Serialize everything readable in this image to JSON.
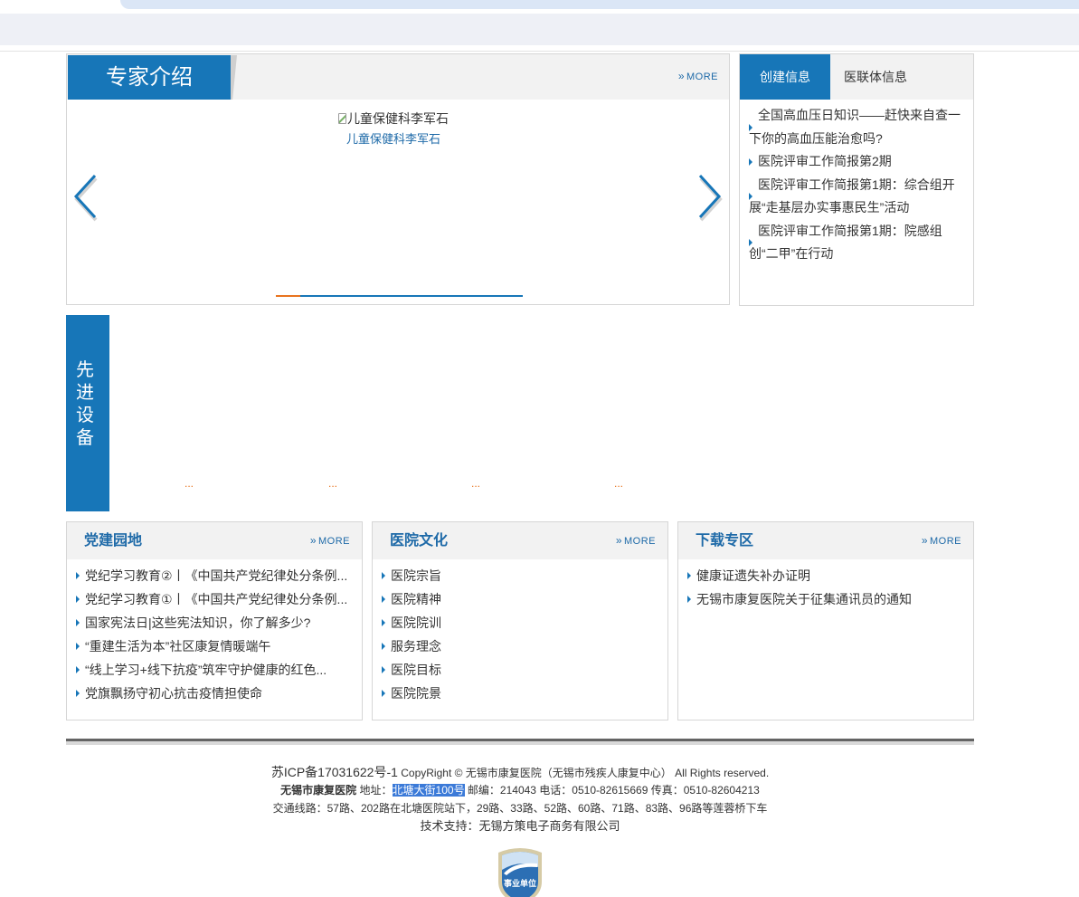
{
  "theme": {
    "primary": "#1776b8",
    "accent_orange": "#e8731e",
    "title_blue": "#1e6aa8",
    "selection": "#3b7ad8"
  },
  "expert": {
    "title": "专家介绍",
    "more_label": "MORE",
    "more_icon": "double-chevron-right-icon",
    "slide": {
      "image_icon": "broken-image-icon",
      "image_alt": "儿童保健科李军石",
      "caption": "儿童保健科李军石"
    },
    "carousel": {
      "prev_icon": "chevron-left-icon",
      "next_icon": "chevron-right-icon",
      "progress": 0.1
    }
  },
  "news": {
    "tabs": [
      {
        "label": "创建信息",
        "active": true
      },
      {
        "label": "医联体信息",
        "active": false
      }
    ],
    "bullet_icon": "triangle-right-icon",
    "items": [
      "全国高血压日知识——赶快来自查一下你的高血压能治愈吗?",
      "医院评审工作简报第2期",
      "医院评审工作简报第1期：综合组开展“走基层办实事惠民生”活动",
      "医院评审工作简报第1期：院感组创“二甲”在行动"
    ]
  },
  "equipment": {
    "title": "先进设备",
    "captions": [
      "...",
      "...",
      "...",
      "..."
    ]
  },
  "panels": [
    {
      "title": "党建园地",
      "more_label": "MORE",
      "items": [
        "党纪学习教育②丨《中国共产党纪律处分条例...",
        "党纪学习教育①丨《中国共产党纪律处分条例...",
        "国家宪法日|这些宪法知识，你了解多少?",
        "“重建生活为本”社区康复情暖端午",
        "“线上学习+线下抗疫”筑牢守护健康的红色...",
        "党旗飘扬守初心抗击疫情担使命"
      ]
    },
    {
      "title": "医院文化",
      "more_label": "MORE",
      "items": [
        "医院宗旨",
        "医院精神",
        "医院院训",
        "服务理念",
        "医院目标",
        "医院院景"
      ]
    },
    {
      "title": "下载专区",
      "more_label": "MORE",
      "items": [
        "健康证遗失补办证明",
        "无锡市康复医院关于征集通讯员的通知"
      ]
    }
  ],
  "footer": {
    "icp": "苏ICP备17031622号-1",
    "copyright": "CopyRight © 无锡市康复医院（无锡市残疾人康复中心） All Rights reserved.",
    "hospital_name": "无锡市康复医院",
    "address_label": "地址：",
    "address": "北塘大街100号",
    "contact": "邮编：214043 电话：0510-82615669 传真：0510-82604213",
    "transit": "交通线路：57路、202路在北塘医院站下，29路、33路、52路、60路、71路、83路、96路等莲蓉桥下车",
    "support_label": "技术支持：",
    "support_company": "无锡方策电子商务有限公司"
  },
  "badge": {
    "label": "事业单位",
    "icon": "public-institution-badge-icon"
  }
}
